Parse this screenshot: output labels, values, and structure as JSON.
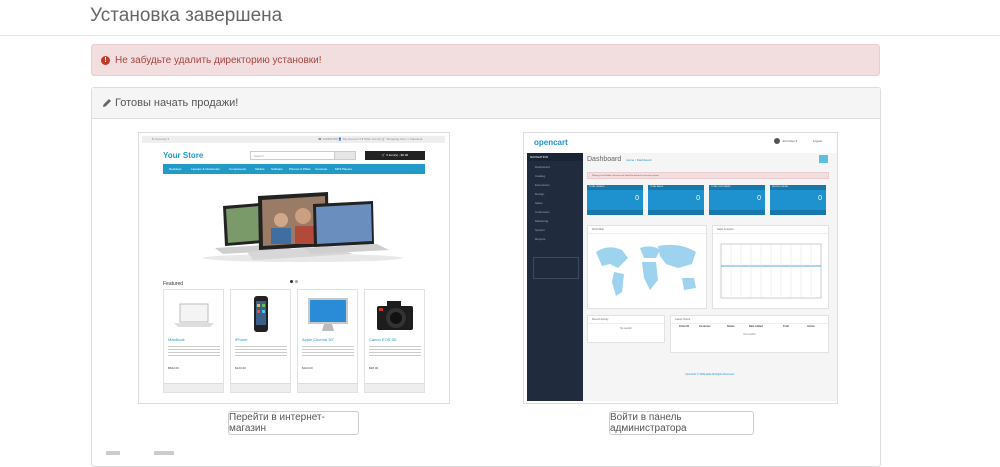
{
  "page": {
    "title": "Установка завершена"
  },
  "alert": {
    "text": "Не забудьте удалить директорию установки!"
  },
  "panel": {
    "heading": "Готовы начать продажи!"
  },
  "store": {
    "top_left": "€ Currency ▾",
    "top_right": "☎ 123456789   👤 My Account ▾   ♥ Wish List (0)   🛒 Shopping Cart   ↪ Checkout",
    "logo": "Your Store",
    "search_placeholder": "Search",
    "cart": "🛒 0 item(s) - $0.00",
    "nav": [
      "Desktops",
      "Laptops & Notebooks",
      "Components",
      "Tablets",
      "Software",
      "Phones & PDAs",
      "Cameras",
      "MP3 Players"
    ],
    "featured": "Featured",
    "products": [
      {
        "name": "MacBook",
        "price": "$602.00"
      },
      {
        "name": "iPhone",
        "price": "$123.20"
      },
      {
        "name": "Apple Cinema 30\"",
        "price": "$110.00"
      },
      {
        "name": "Canon EOS 5D",
        "price": "$98.00"
      }
    ],
    "add_to_cart": "ADD TO CART"
  },
  "admin": {
    "logo": "opencart",
    "user": "John Doe ▾",
    "logout": "Logout",
    "navigation": "NAVIGATION",
    "sidebar": [
      "Dashboard",
      "Catalog",
      "Extensions",
      "Design",
      "Sales",
      "Customers",
      "Marketing",
      "System",
      "Reports"
    ],
    "title": "Dashboard",
    "breadcrumb": "Home / Dashboard",
    "alert": "Warning: Install folder still exists and should be deleted for security reasons!",
    "tiles": [
      {
        "label": "TOTAL ORDERS",
        "value": "0"
      },
      {
        "label": "TOTAL SALES",
        "value": "0"
      },
      {
        "label": "TOTAL CUSTOMERS",
        "value": "0"
      },
      {
        "label": "PEOPLE ONLINE",
        "value": "0"
      }
    ],
    "world_map": "World Map",
    "sales_analytics": "Sales Analytics",
    "recent_activity": "Recent Activity",
    "latest_orders": "Latest Orders",
    "no_results": "No results!",
    "orders_cols": [
      "Order ID",
      "Customer",
      "Status",
      "Date Added",
      "Total",
      "Action"
    ],
    "footer": "OpenCart © 2009-2024 All Rights Reserved."
  },
  "buttons": {
    "go_store": "Перейти в интернет-магазин",
    "go_admin": "Войти в панель администратора"
  },
  "colors": {
    "alert_bg": "#f2dede",
    "alert_text": "#a94442",
    "store_blue": "#229ac8",
    "admin_blue": "#1e91cf",
    "admin_dark": "#202c3d"
  }
}
